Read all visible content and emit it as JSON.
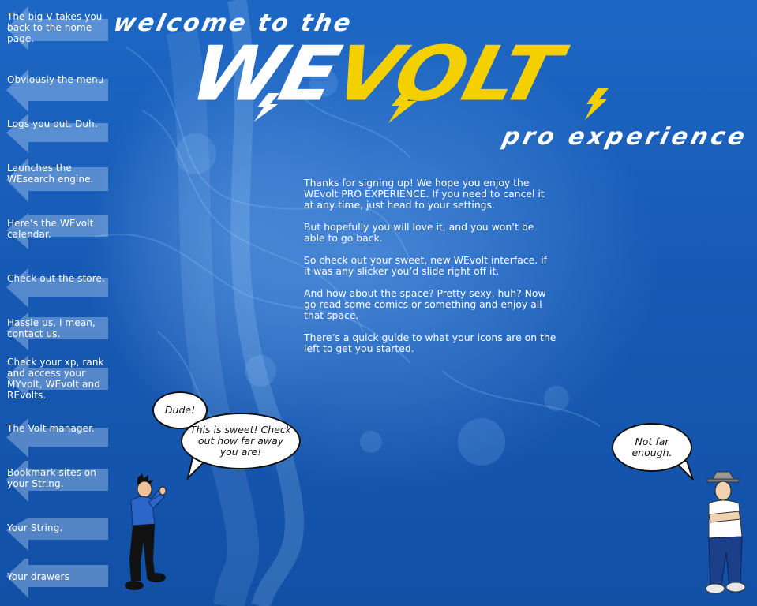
{
  "header": {
    "welcome": "welcome to the",
    "logo_we": "WE",
    "logo_volt": "VOLT",
    "subtitle": "pro experience"
  },
  "guide": [
    {
      "label": "The big V takes you back to the home page."
    },
    {
      "label": "Obviously the menu"
    },
    {
      "label": "Logs you out. Duh."
    },
    {
      "label": "Launches the WEsearch engine."
    },
    {
      "label": "Here’s the WEvolt calendar."
    },
    {
      "label": "Check out the store."
    },
    {
      "label": "Hassle us, I mean, contact us."
    },
    {
      "label": "Check your xp, rank and access your MYvolt, WEvolt and REvolts."
    },
    {
      "label": "The Volt manager."
    },
    {
      "label": "Bookmark sites on your String."
    },
    {
      "label": "Your String."
    },
    {
      "label": "Your drawers"
    }
  ],
  "intro": {
    "p1": "Thanks for signing up! We hope you enjoy the WEvolt PRO EXPERIENCE. If you need to cancel it at any time, just head to your settings.",
    "p2": "But hopefully you will love it, and you won’t be able to go back.",
    "p3": "So check out your sweet, new WEvolt interface. if it was any slicker you’d slide right off it.",
    "p4": "And how about the space? Pretty sexy, huh? Now go read some comics or something and enjoy all that space.",
    "p5": "There’s a quick guide to what your icons are on the left to get you started."
  },
  "bubbles": {
    "dude": "Dude!",
    "sweet": "This is sweet! Check out how far away you are!",
    "not_far": "Not far enough."
  },
  "colors": {
    "accent_yellow": "#f5d000",
    "background_blue": "#1a5cb0",
    "text_white": "#ffffff"
  }
}
